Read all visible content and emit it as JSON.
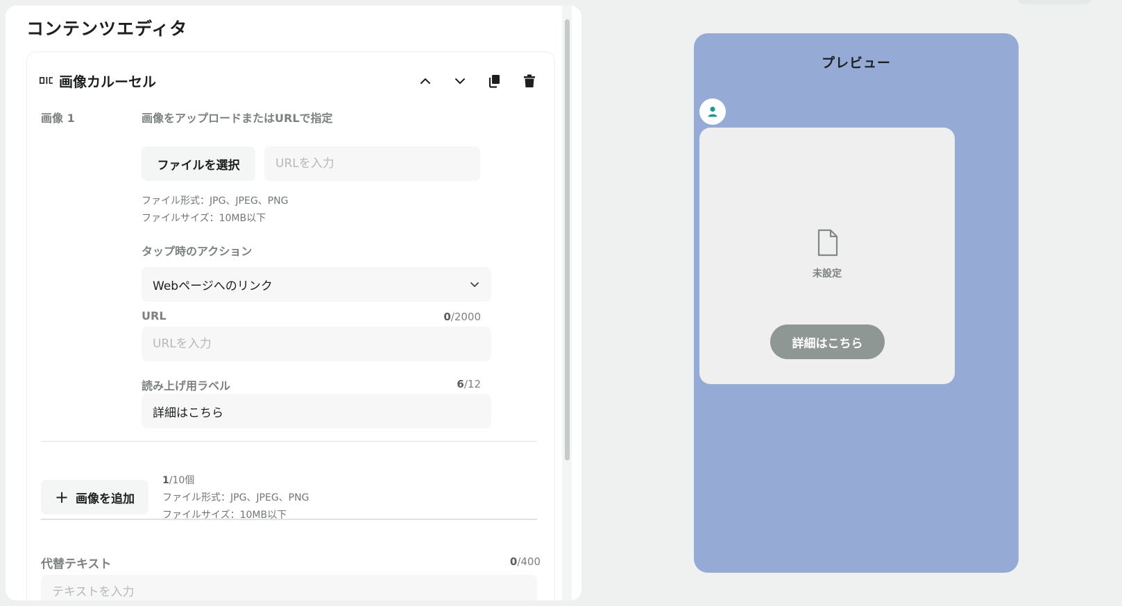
{
  "editor": {
    "title": "コンテンツエディタ",
    "block": {
      "title": "画像カルーセル",
      "icons": {
        "block_type": "image-carousel-icon",
        "move_up": "chevron-up-icon",
        "move_down": "chevron-down-icon",
        "duplicate": "copy-icon",
        "delete": "trash-icon"
      },
      "image_item": {
        "label": "画像 1",
        "upload_heading": "画像をアップロードまたはURLで指定",
        "file_button_label": "ファイルを選択",
        "url_placeholder": "URLを入力",
        "file_format_hint": "ファイル形式：JPG、JPEG、PNG",
        "file_size_hint": "ファイルサイズ：10MB以下",
        "tap_action": {
          "label": "タップ時のアクション",
          "selected": "Webページへのリンク"
        },
        "url_field": {
          "label": "URL",
          "placeholder": "URLを入力",
          "count_current": "0",
          "count_max": "/2000"
        },
        "aria_label_field": {
          "label": "読み上げ用ラベル",
          "value": "詳細はこちら",
          "count_current": "6",
          "count_max": "/12"
        }
      },
      "add_image": {
        "button_label": "画像を追加",
        "count_current": "1",
        "count_suffix": "/10個",
        "file_format_hint": "ファイル形式：JPG、JPEG、PNG",
        "file_size_hint": "ファイルサイズ：10MB以下"
      },
      "alt_text": {
        "label": "代替テキスト",
        "placeholder": "テキストを入力",
        "count_current": "0",
        "count_max": "/400"
      }
    }
  },
  "preview": {
    "title": "プレビュー",
    "avatar_icon": "user-icon",
    "card": {
      "placeholder_icon": "file-icon",
      "placeholder_label": "未設定",
      "button_label": "詳細はこちら"
    }
  },
  "colors": {
    "preview_background": "#95abd6",
    "avatar_accent": "#1a9a8f",
    "button_gray": "#8f9795"
  }
}
